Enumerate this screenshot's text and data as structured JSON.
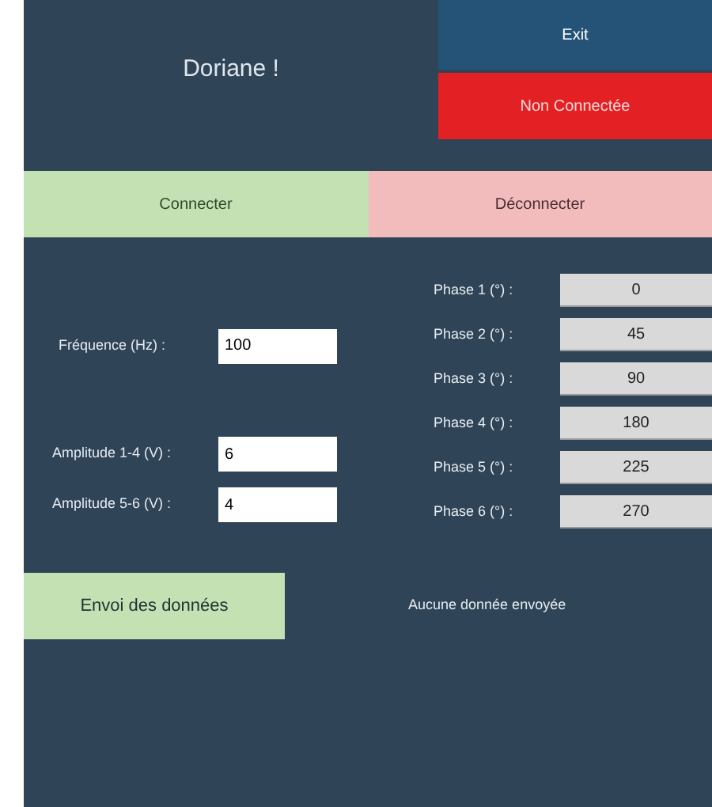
{
  "greeting": "Doriane !",
  "exit_button": "Exit",
  "connection_status": {
    "label": "Non Connectée",
    "connected": false
  },
  "connect_buttons": [
    {
      "label": "Connecter",
      "kind": "connect"
    },
    {
      "label": "Déconnecter",
      "kind": "disconnect"
    }
  ],
  "frequency": {
    "label": "Fréquence (Hz) :",
    "value": "100"
  },
  "amplitudes": [
    {
      "label": "Amplitude 1-4 (V) :",
      "value": "6"
    },
    {
      "label": "Amplitude 5-6 (V) :",
      "value": "4"
    }
  ],
  "phases": [
    {
      "label": "Phase 1 (°) :",
      "value": "0"
    },
    {
      "label": "Phase 2 (°) :",
      "value": "45"
    },
    {
      "label": "Phase 3 (°) :",
      "value": "90"
    },
    {
      "label": "Phase 4 (°) :",
      "value": "180"
    },
    {
      "label": "Phase 5 (°) :",
      "value": "225"
    },
    {
      "label": "Phase 6 (°) :",
      "value": "270"
    }
  ],
  "send_button": "Envoi des données",
  "send_status": "Aucune donnée envoyée"
}
